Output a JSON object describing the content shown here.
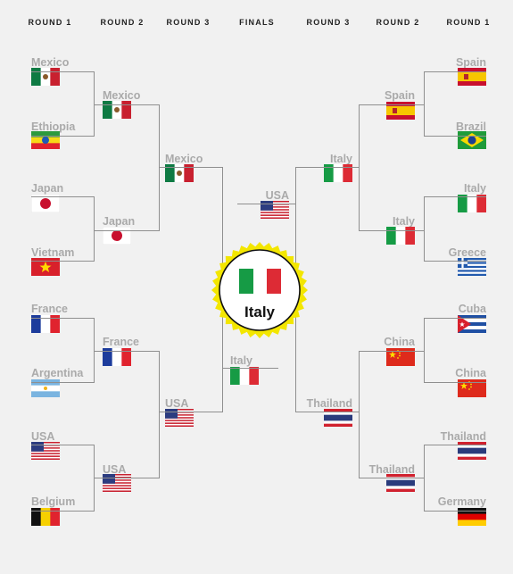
{
  "headers": {
    "left_r1": "ROUND 1",
    "left_r2": "ROUND 2",
    "left_r3": "ROUND 3",
    "finals": "FINALS",
    "right_r3": "ROUND 3",
    "right_r2": "ROUND 2",
    "right_r1": "ROUND 1"
  },
  "left": {
    "round1": [
      "Mexico",
      "Ethiopia",
      "Japan",
      "Vietnam",
      "France",
      "Argentina",
      "USA",
      "Belgium"
    ],
    "round2": [
      "Mexico",
      "Japan",
      "France",
      "USA"
    ],
    "round3": [
      "Mexico",
      "USA"
    ],
    "finalist": "Italy"
  },
  "right": {
    "round1": [
      "Spain",
      "Brazil",
      "Italy",
      "Greece",
      "Cuba",
      "China",
      "Thailand",
      "Germany"
    ],
    "round2": [
      "Spain",
      "Italy",
      "China",
      "Thailand"
    ],
    "round3": [
      "Italy",
      "Thailand"
    ],
    "finalist": "USA"
  },
  "champion": "Italy",
  "colors": {
    "background": "#f1f1f1",
    "bracket_line": "#8f8f8f",
    "team_name": "#aaaaaa",
    "badge_yellow": "#f3e600",
    "badge_ring": "#111111"
  },
  "flags": {
    "Mexico": "flag-mexico-icon",
    "Ethiopia": "flag-ethiopia-icon",
    "Japan": "flag-japan-icon",
    "Vietnam": "flag-vietnam-icon",
    "France": "flag-france-icon",
    "Argentina": "flag-argentina-icon",
    "USA": "flag-usa-icon",
    "Belgium": "flag-belgium-icon",
    "Spain": "flag-spain-icon",
    "Brazil": "flag-brazil-icon",
    "Italy": "flag-italy-icon",
    "Greece": "flag-greece-icon",
    "Cuba": "flag-cuba-icon",
    "China": "flag-china-icon",
    "Thailand": "flag-thailand-icon",
    "Germany": "flag-germany-icon"
  }
}
